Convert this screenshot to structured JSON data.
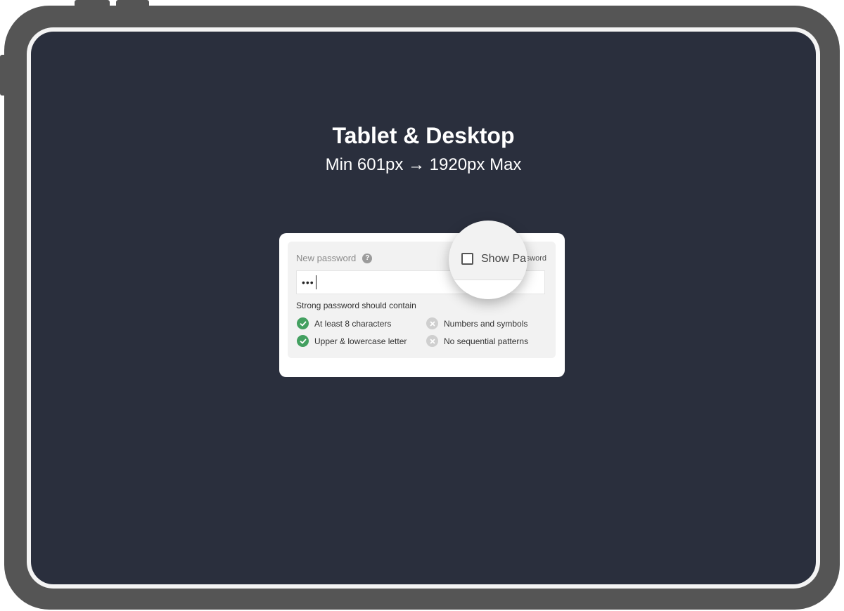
{
  "header": {
    "title": "Tablet & Desktop",
    "subtitle": "Min 601px → 1920px Max"
  },
  "form": {
    "field_label": "New password",
    "help_icon_glyph": "?",
    "show_password_label": "Show Pa",
    "show_password_tail": "sword",
    "show_password_checked": false,
    "password_value": "•••",
    "hint_title": "Strong password should contain",
    "requirements": [
      {
        "label": "At least 8 characters",
        "met": true,
        "icon": "check-circle-icon"
      },
      {
        "label": "Numbers and symbols",
        "met": false,
        "icon": "x-circle-icon"
      },
      {
        "label": "Upper & lowercase letter",
        "met": true,
        "icon": "check-circle-icon"
      },
      {
        "label": "No sequential patterns",
        "met": false,
        "icon": "x-circle-icon"
      }
    ]
  },
  "colors": {
    "screen_bg": "#2a2f3d",
    "met": "#43a060",
    "unmet": "#cfcfcf",
    "device_frame": "#555555"
  }
}
